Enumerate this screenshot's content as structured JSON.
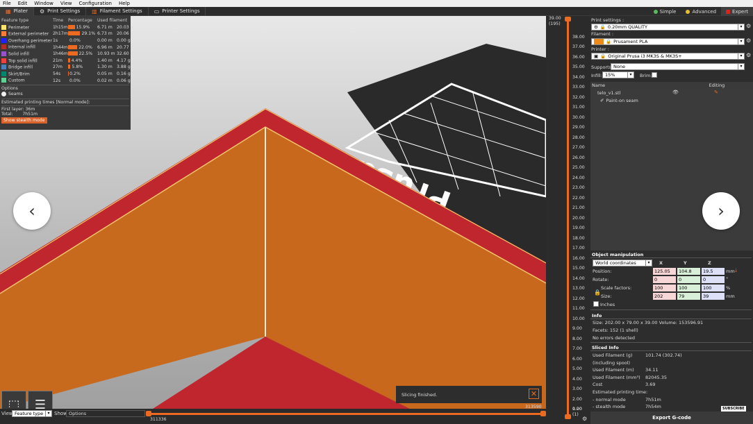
{
  "menu": [
    "File",
    "Edit",
    "Window",
    "View",
    "Configuration",
    "Help"
  ],
  "tabs": [
    {
      "label": "Plater",
      "icon": "plater-icon"
    },
    {
      "label": "Print Settings",
      "icon": "gear-icon"
    },
    {
      "label": "Filament Settings",
      "icon": "spool-icon"
    },
    {
      "label": "Printer Settings",
      "icon": "printer-icon"
    }
  ],
  "modes": [
    {
      "label": "Simple",
      "color": "#5cb85c"
    },
    {
      "label": "Advanced",
      "color": "#e5c02b"
    },
    {
      "label": "Expert",
      "color": "#d9261c"
    }
  ],
  "legend": {
    "headers": {
      "type": "Feature type",
      "time": "Time",
      "pct": "Percentage",
      "fil": "Used filament"
    },
    "rows": [
      {
        "name": "Perimeter",
        "color": "#ffe56e",
        "time": "1h15m",
        "pct": "15.9%",
        "pctv": 15.9,
        "m": "6.71 m",
        "g": "20.03 g"
      },
      {
        "name": "External perimeter",
        "color": "#ff7d38",
        "time": "2h17m",
        "pct": "29.1%",
        "pctv": 29.1,
        "m": "6.73 m",
        "g": "20.06 g"
      },
      {
        "name": "Overhang perimeter",
        "color": "#1f1fff",
        "time": "1s",
        "pct": "0.0%",
        "pctv": 0,
        "m": "0.00 m",
        "g": "0.00 g"
      },
      {
        "name": "Internal infill",
        "color": "#b03029",
        "time": "1h44m",
        "pct": "22.0%",
        "pctv": 22.0,
        "m": "6.96 m",
        "g": "20.77 g"
      },
      {
        "name": "Solid infill",
        "color": "#9654cc",
        "time": "1h46m",
        "pct": "22.5%",
        "pctv": 22.5,
        "m": "10.93 m",
        "g": "32.60 g"
      },
      {
        "name": "Top solid infill",
        "color": "#f04040",
        "time": "21m",
        "pct": "4.4%",
        "pctv": 4.4,
        "m": "1.40 m",
        "g": "4.17 g"
      },
      {
        "name": "Bridge infill",
        "color": "#4d80ba",
        "time": "27m",
        "pct": "5.8%",
        "pctv": 5.8,
        "m": "1.30 m",
        "g": "3.88 g"
      },
      {
        "name": "Skirt/Brim",
        "color": "#00876e",
        "time": "54s",
        "pct": "0.2%",
        "pctv": 0.2,
        "m": "0.05 m",
        "g": "0.16 g"
      },
      {
        "name": "Custom",
        "color": "#5ed194",
        "time": "12s",
        "pct": "0.0%",
        "pctv": 0,
        "m": "0.02 m",
        "g": "0.06 g"
      }
    ],
    "options_label": "Options",
    "seams_label": "Seams",
    "est_label": "Estimated printing times [Normal mode]:",
    "first_layer": "First layer: 36m",
    "total_label": "Total:",
    "total_value": "7h51m",
    "stealth_button": "Show stealth mode"
  },
  "vslider": {
    "top_value": "39.00",
    "top_layer": "(195)",
    "ticks": [
      "39.00",
      "38.00",
      "37.00",
      "36.00",
      "35.00",
      "34.00",
      "33.00",
      "32.00",
      "31.00",
      "30.00",
      "29.00",
      "28.00",
      "27.00",
      "26.00",
      "25.00",
      "24.00",
      "23.00",
      "22.00",
      "21.00",
      "20.00",
      "19.00",
      "18.00",
      "17.00",
      "16.00",
      "15.00",
      "14.00",
      "13.00",
      "12.00",
      "11.00",
      "10.00",
      "9.00",
      "8.00",
      "7.00",
      "6.00",
      "5.00",
      "4.00",
      "3.00",
      "2.00",
      "1.00"
    ],
    "bottom_value": "0.20",
    "bottom_layer": "(1)"
  },
  "hslider": {
    "left_value": "311336",
    "right_value": "313590"
  },
  "bottom": {
    "view_label": "View",
    "view_value": "Feature type",
    "show_label": "Show",
    "options_label": "Options"
  },
  "toast": {
    "text": "Slicing finished."
  },
  "plate_text": "Prusa",
  "right": {
    "print_settings_label": "Print settings :",
    "print_settings_value": "0.20mm QUALITY",
    "filament_label": "Filament :",
    "filament_value": "Prusament PLA",
    "filament_color": "#ed8a1c",
    "printer_label": "Printer :",
    "printer_value": "Original Prusa i3 MK3S & MK3S+",
    "supports_label": "Supports:",
    "supports_value": "None",
    "infill_label": "Infill:",
    "infill_value": "15%",
    "brim_label": "Brim:",
    "col_name": "Name",
    "col_editing": "Editing",
    "object_name": "telo_v1.stl",
    "subitem": "Paint-on seam",
    "om_title": "Object manipulation",
    "coords_value": "World coordinates",
    "axis": [
      "X",
      "Y",
      "Z"
    ],
    "position_label": "Position:",
    "position": [
      "125.05",
      "104.8",
      "19.5"
    ],
    "rotate_label": "Rotate:",
    "rotate": [
      "0",
      "0",
      "0"
    ],
    "scale_label": "Scale factors:",
    "scale": [
      "100",
      "100",
      "100"
    ],
    "size_label": "Size:",
    "size": [
      "202",
      "79",
      "39"
    ],
    "unit_mm": "mm",
    "unit_deg": "°",
    "unit_pct": "%",
    "inches_label": "Inches",
    "info_title": "Info",
    "info_size": "Size:   202.00 x 79.00 x 39.00  Volume:   153596.91",
    "info_facets": "Facets:  152 (1 shell)",
    "info_errors": "No errors detected",
    "sliced_title": "Sliced Info",
    "sliced": [
      {
        "k": "Used Filament (g)",
        "v": "101.74 (302.74)"
      },
      {
        "k": "   (including spool)",
        "v": ""
      },
      {
        "k": "Used Filament (m)",
        "v": "34.11"
      },
      {
        "k": "Used Filament (mm³)",
        "v": "82045.35"
      },
      {
        "k": "Cost",
        "v": "3.69"
      },
      {
        "k": "Estimated printing time:",
        "v": ""
      },
      {
        "k": " - normal mode",
        "v": "7h51m"
      },
      {
        "k": " - stealth mode",
        "v": "7h54m"
      }
    ],
    "subscribe": "SUBSCRIBE",
    "export_button": "Export G-code"
  }
}
